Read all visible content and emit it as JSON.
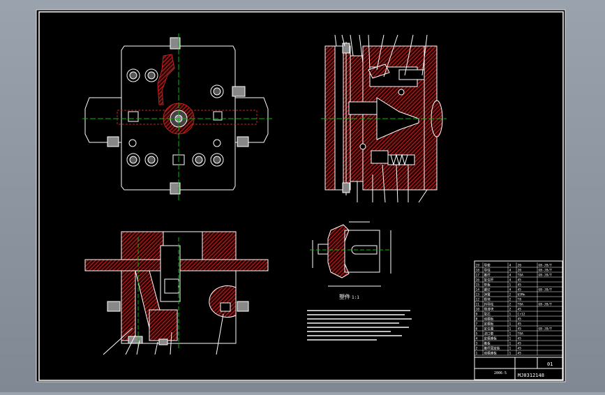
{
  "drawing": {
    "number": "MJ0312148",
    "bom_title_block": {
      "left_note": "",
      "sheet_code": "01",
      "date": "2006-5",
      "rows": [
        {
          "no": "19",
          "name": "导套",
          "qty": "4",
          "mat": "20",
          "std": "GB-JB/T"
        },
        {
          "no": "18",
          "name": "导柱",
          "qty": "4",
          "mat": "20",
          "std": "GB-JB/T"
        },
        {
          "no": "17",
          "name": "推杆",
          "qty": "4",
          "mat": "T8A",
          "std": "GB-JB/T"
        },
        {
          "no": "16",
          "name": "复位杆",
          "qty": "4",
          "mat": "45",
          "std": ""
        },
        {
          "no": "15",
          "name": "垫板",
          "qty": "1",
          "mat": "45",
          "std": ""
        },
        {
          "no": "14",
          "name": "螺钉",
          "qty": "4",
          "mat": "45",
          "std": "GB-JB/T"
        },
        {
          "no": "13",
          "name": "弹簧",
          "qty": "2",
          "mat": "65Mn",
          "std": ""
        },
        {
          "no": "12",
          "name": "楔块",
          "qty": "2",
          "mat": "T8",
          "std": ""
        },
        {
          "no": "11",
          "name": "斜导柱",
          "qty": "2",
          "mat": "T8A",
          "std": "GB-JB/T"
        },
        {
          "no": "10",
          "name": "侧滑块",
          "qty": "2",
          "mat": "45",
          "std": ""
        },
        {
          "no": "9",
          "name": "型芯",
          "qty": "1",
          "mat": "Cr12",
          "std": ""
        },
        {
          "no": "8",
          "name": "动模板",
          "qty": "1",
          "mat": "45",
          "std": ""
        },
        {
          "no": "7",
          "name": "定模板",
          "qty": "1",
          "mat": "45",
          "std": ""
        },
        {
          "no": "6",
          "name": "定位圈",
          "qty": "1",
          "mat": "45",
          "std": "GB-JB/T"
        },
        {
          "no": "5",
          "name": "浇口套",
          "qty": "1",
          "mat": "T8A",
          "std": ""
        },
        {
          "no": "4",
          "name": "定模座板",
          "qty": "1",
          "mat": "45",
          "std": ""
        },
        {
          "no": "3",
          "name": "推板",
          "qty": "1",
          "mat": "45",
          "std": ""
        },
        {
          "no": "2",
          "name": "推杆固定板",
          "qty": "1",
          "mat": "45",
          "std": ""
        },
        {
          "no": "1",
          "name": "动模座板",
          "qty": "1",
          "mat": "45",
          "std": ""
        }
      ]
    },
    "part_view_label": "塑件",
    "part_scale": "1:1"
  },
  "colors": {
    "canvas": "#000000",
    "frame": "#ffffff",
    "hatch": "#b02020",
    "line": "#ffffff",
    "center": "#00c000",
    "hole": "#c8c8c8"
  }
}
